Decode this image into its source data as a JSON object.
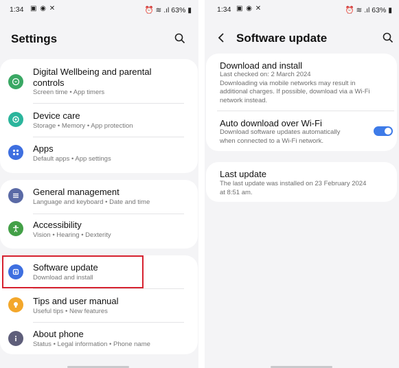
{
  "left": {
    "status": {
      "time": "1:34",
      "battery": "63%"
    },
    "title": "Settings",
    "items": [
      {
        "label": "Digital Wellbeing and parental controls",
        "sub": "Screen time  •  App timers",
        "color": "#3aa864"
      },
      {
        "label": "Device care",
        "sub": "Storage  •  Memory  •  App protection",
        "color": "#2bb59c"
      },
      {
        "label": "Apps",
        "sub": "Default apps  •  App settings",
        "color": "#3e6fe0"
      },
      {
        "label": "General management",
        "sub": "Language and keyboard  •  Date and time",
        "color": "#5a6aa6"
      },
      {
        "label": "Accessibility",
        "sub": "Vision  •  Hearing  •  Dexterity",
        "color": "#43a047"
      },
      {
        "label": "Software update",
        "sub": "Download and install",
        "color": "#3e6fe0"
      },
      {
        "label": "Tips and user manual",
        "sub": "Useful tips  •  New features",
        "color": "#f3a72b"
      },
      {
        "label": "About phone",
        "sub": "Status  •  Legal information  •  Phone name",
        "color": "#5e5e7a"
      }
    ]
  },
  "right": {
    "status": {
      "time": "1:34",
      "battery": "63%"
    },
    "title": "Software update",
    "download": {
      "label": "Download and install",
      "sub1": "Last checked on: 2 March 2024",
      "sub2": "Downloading via mobile networks may result in",
      "sub3": "additional charges. If possible, download via a Wi-Fi",
      "sub4": "network instead."
    },
    "auto": {
      "label": "Auto download over Wi-Fi",
      "sub1": "Download software updates automatically",
      "sub2": "when connected to a Wi-Fi network.",
      "enabled": true,
      "toggle_color": "#3e7be8"
    },
    "last": {
      "label": "Last update",
      "sub1": "The last update was installed on 23 February 2024",
      "sub2": "at 8:51 am."
    }
  }
}
